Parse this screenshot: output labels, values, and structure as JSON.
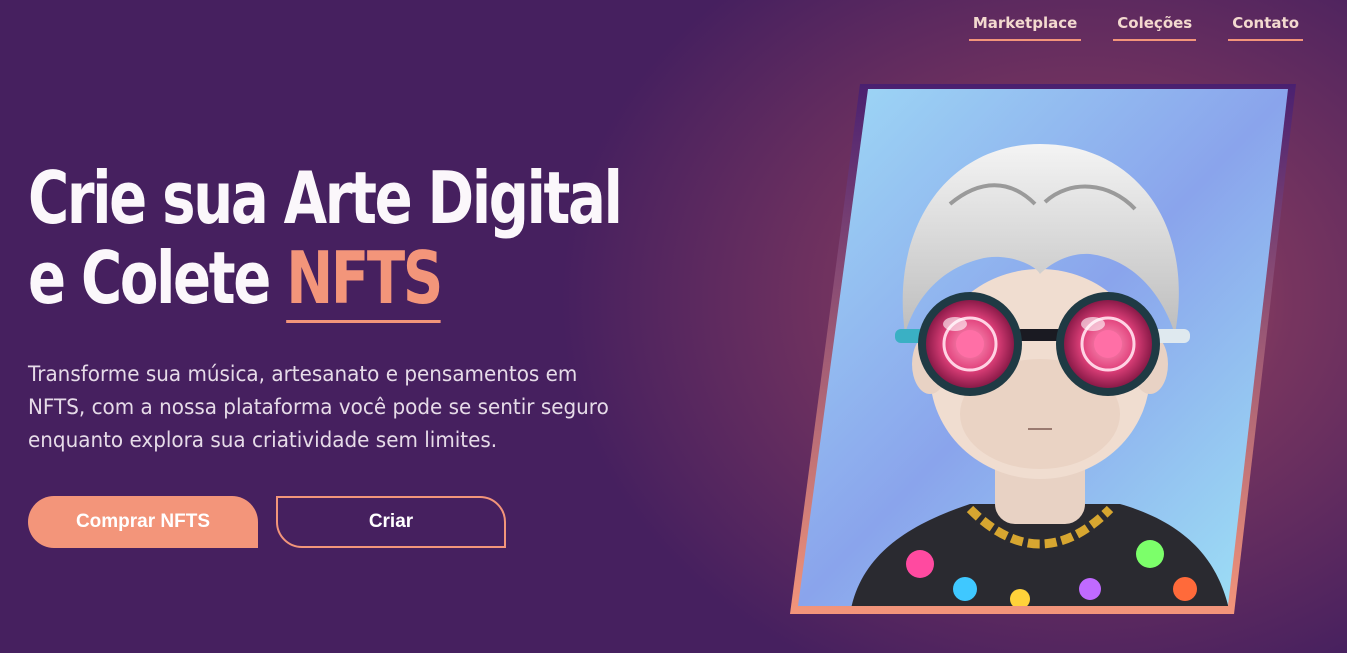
{
  "nav": {
    "items": [
      {
        "label": "Marketplace"
      },
      {
        "label": "Coleções"
      },
      {
        "label": "Contato"
      }
    ]
  },
  "hero": {
    "title_line1": "Crie sua Arte Digital",
    "title_line2_prefix": "e Colete ",
    "title_highlight": "NFTS",
    "description": "Transforme sua música, artesanato e pensamentos em NFTS, com a nossa plataforma você pode se sentir seguro enquanto explora sua criatividade sem limites.",
    "buy_button": "Comprar NFTS",
    "create_button": "Criar"
  },
  "colors": {
    "background": "#46205f",
    "accent": "#f3957a",
    "glow": "#c85c5c"
  },
  "image": {
    "subject": "nft-avatar-illustration"
  }
}
